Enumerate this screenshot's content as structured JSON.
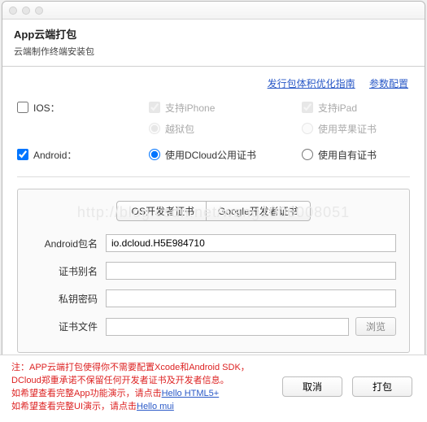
{
  "header": {
    "title": "App云端打包",
    "subtitle": "云端制作终端安装包"
  },
  "links": {
    "guide": "发行包体积优化指南",
    "params": "参数配置"
  },
  "platform": {
    "ios": {
      "label": "IOS：",
      "opt_iphone": "支持iPhone",
      "opt_ipad": "支持iPad",
      "opt_jailbreak": "越狱包",
      "opt_applecert": "使用苹果证书"
    },
    "android": {
      "label": "Android：",
      "opt_dcloud": "使用DCloud公用证书",
      "opt_owncert": "使用自有证书"
    }
  },
  "tabs": {
    "ios": "IOS开发者证书",
    "google": "Google开发者证书"
  },
  "form": {
    "pkg_label": "Android包名",
    "pkg_value": "io.dcloud.H5E984710",
    "alias_label": "证书别名",
    "alias_value": "",
    "pwd_label": "私钥密码",
    "pwd_value": "",
    "file_label": "证书文件",
    "file_value": "",
    "browse": "浏览"
  },
  "note": {
    "prefix": "注：",
    "line1": "APP云端打包使得你不需要配置Xcode和Android SDK，",
    "line2": "DCloud郑重承诺不保留任何开发者证书及开发者信息。",
    "line3a": "如希望查看完整App功能演示，请点击",
    "link1": "Hello HTML5+",
    "line4a": "如希望查看完整UI演示，请点击",
    "link2": "Hello mui"
  },
  "buttons": {
    "cancel": "取消",
    "pack": "打包"
  },
  "watermark": "http://blog.csdn.net/wang1006008051"
}
